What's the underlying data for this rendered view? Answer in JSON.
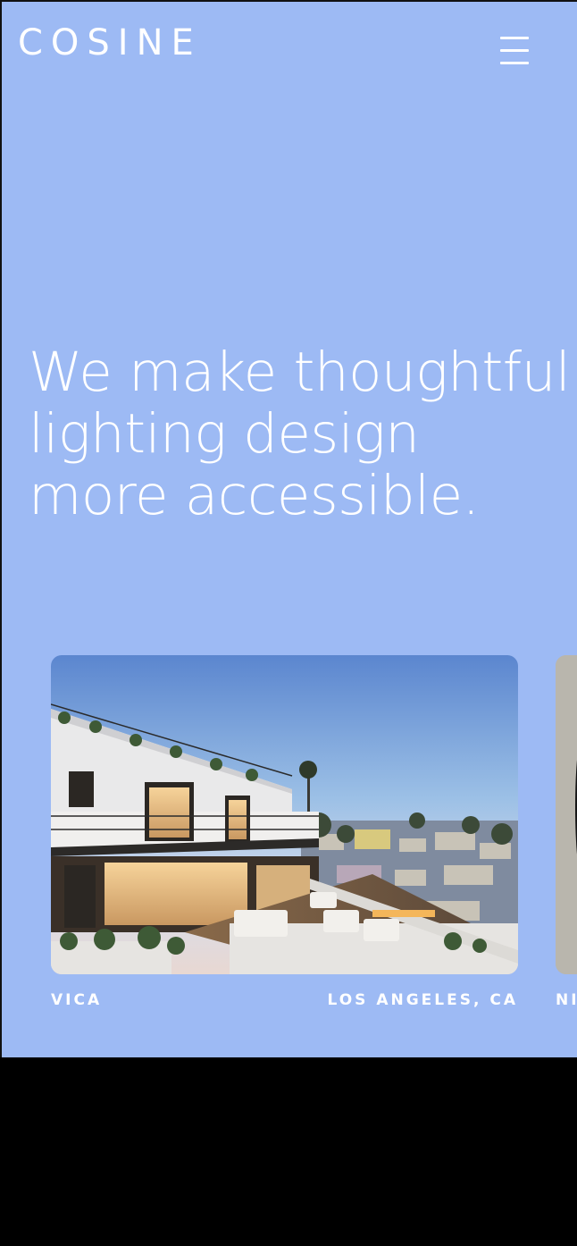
{
  "header": {
    "logo": "COSINE",
    "menu_icon": "hamburger-menu-icon"
  },
  "hero": {
    "headline": "We make thoughtful lighting design more accessible."
  },
  "projects": [
    {
      "name": "VICA",
      "location": "LOS ANGELES, CA",
      "image": "rooftop-terrace-photo"
    },
    {
      "name": "NI",
      "location": "",
      "image": "portrait-photo"
    }
  ],
  "colors": {
    "hero_background": "#9dbaf4",
    "text": "#ffffff",
    "footer_background": "#000000"
  }
}
